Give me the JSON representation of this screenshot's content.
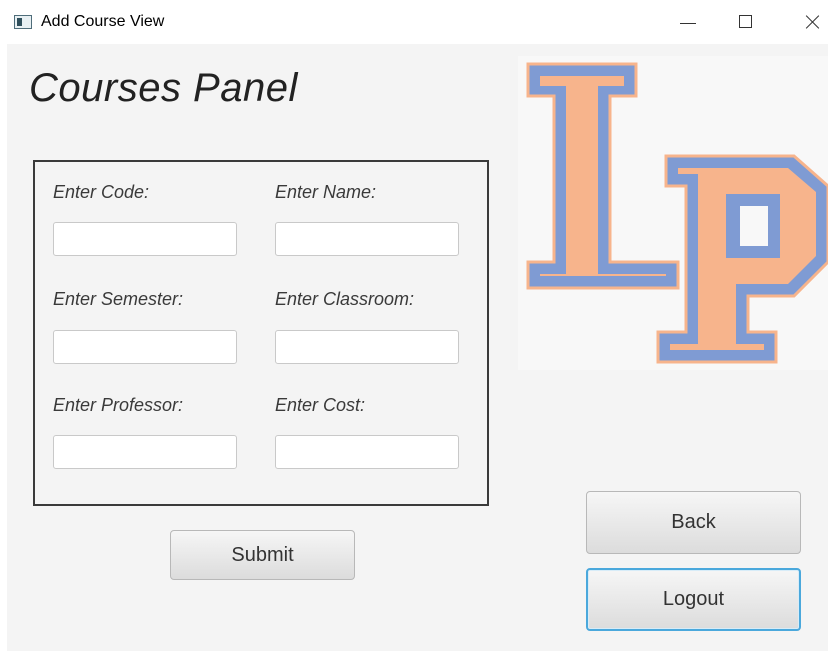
{
  "window": {
    "title": "Add Course View"
  },
  "panel": {
    "title": "Courses Panel"
  },
  "form": {
    "code_label": "Enter Code:",
    "code_value": "",
    "name_label": "Enter Name:",
    "name_value": "",
    "semester_label": "Enter Semester:",
    "semester_value": "",
    "classroom_label": "Enter Classroom:",
    "classroom_value": "",
    "professor_label": "Enter Professor:",
    "professor_value": "",
    "cost_label": "Enter Cost:",
    "cost_value": ""
  },
  "buttons": {
    "submit": "Submit",
    "back": "Back",
    "logout": "Logout"
  },
  "logo": {
    "text": "LP",
    "fill_color": "#f7b48c",
    "outline_color": "#7f9bd3"
  },
  "icons": {
    "app": "app-window-icon",
    "minimize": "minimize-icon",
    "maximize": "maximize-icon",
    "close": "close-icon"
  }
}
